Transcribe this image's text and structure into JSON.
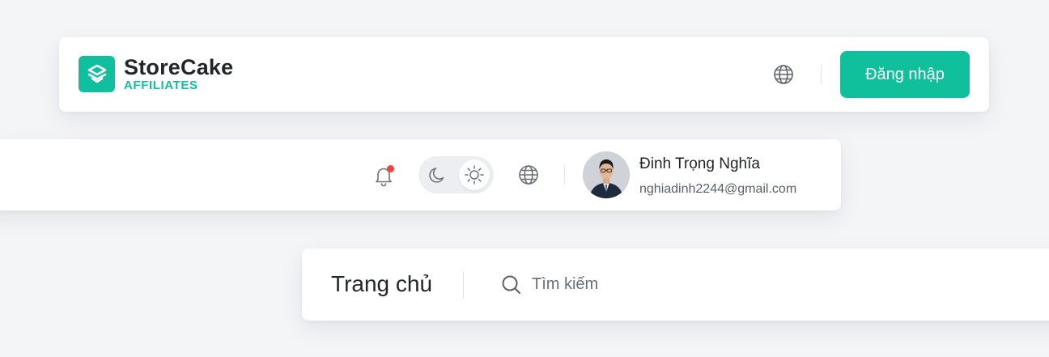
{
  "public_header": {
    "brand_name": "StoreCake",
    "brand_sub": "AFFILIATES",
    "language_icon": "globe-icon",
    "login_label": "Đăng nhập"
  },
  "user_header": {
    "notification_icon": "bell-icon",
    "has_unread_notifications": true,
    "theme_options": [
      "moon-icon",
      "sun-icon"
    ],
    "active_theme": "light",
    "language_icon": "globe-icon",
    "user_name": "Đinh Trọng Nghĩa",
    "user_email": "nghiadinh2244@gmail.com"
  },
  "page_header": {
    "title": "Trang chủ",
    "search_icon": "search-icon",
    "search_placeholder": "Tìm kiếm"
  },
  "colors": {
    "brand": "#10bf9b",
    "background": "#f4f5f7",
    "notification_dot": "#f0443f"
  }
}
